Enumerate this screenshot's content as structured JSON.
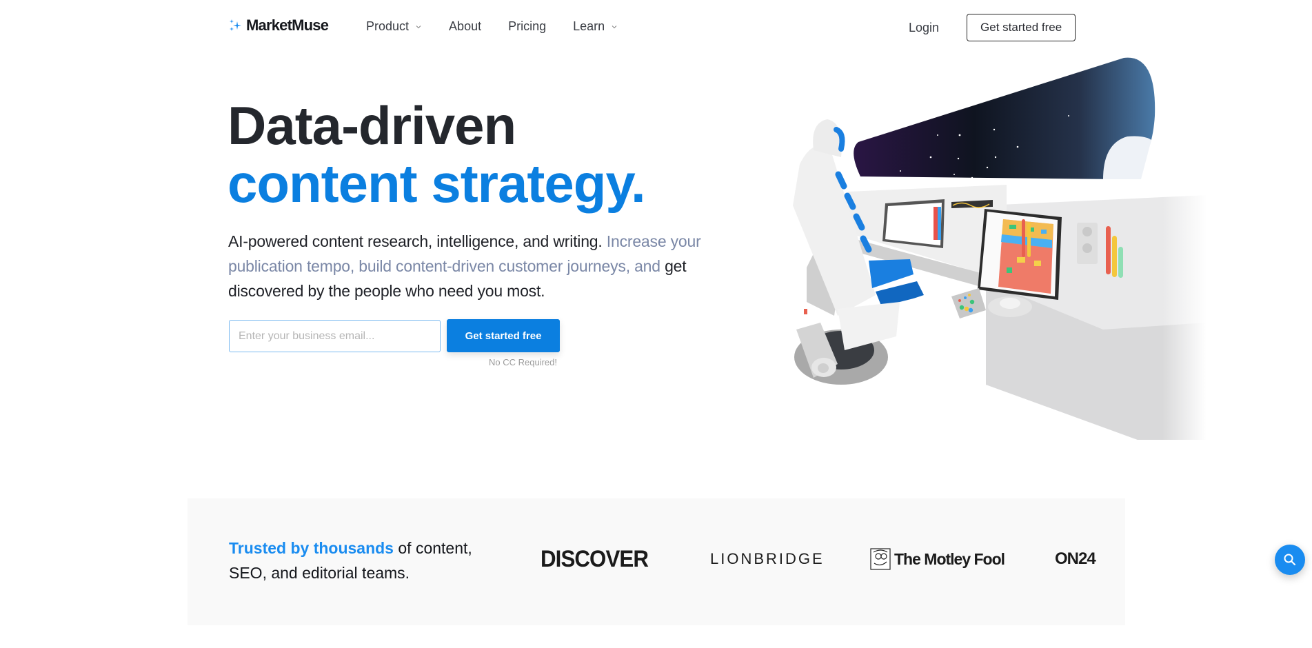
{
  "nav": {
    "brand": "MarketMuse",
    "links": [
      {
        "label": "Product",
        "has_dropdown": true
      },
      {
        "label": "About",
        "has_dropdown": false
      },
      {
        "label": "Pricing",
        "has_dropdown": false
      },
      {
        "label": "Learn",
        "has_dropdown": true
      }
    ],
    "login": "Login",
    "cta": "Get started free"
  },
  "hero": {
    "headline_line1": "Data-driven",
    "headline_line2": "content strategy.",
    "sub_part1": "AI-powered content research, intelligence, and writing.",
    "sub_part2_muted": "Increase your publication tempo, build content-driven customer journeys, and",
    "sub_part3": "get discovered by the people who need you most.",
    "email_placeholder": "Enter your business email...",
    "email_value": "",
    "cta": "Get started free",
    "note": "No CC Required!"
  },
  "trust": {
    "highlight": "Trusted by thousands",
    "rest": "of content, SEO, and editorial teams.",
    "logos": [
      "DISCOVER",
      "LIONBRIDGE",
      "The Motley Fool",
      "ON24"
    ]
  },
  "floating": {
    "icon": "search-icon"
  },
  "colors": {
    "brand_blue": "#0b7fe0",
    "muted_text": "#7a87a6",
    "band_bg": "#f9f9f9"
  }
}
